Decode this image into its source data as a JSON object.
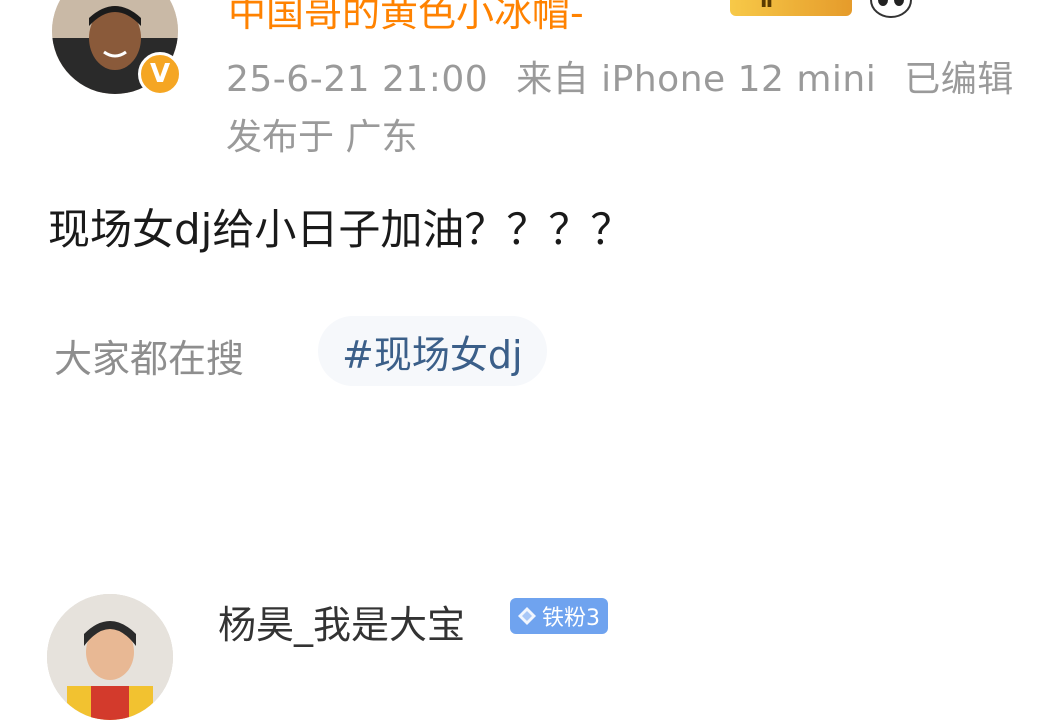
{
  "post": {
    "author_name": "中国哥的黄色小冰帽-",
    "verified_badge": "V",
    "level_badge": "Ⅱ",
    "timestamp": "25-6-21 21:00",
    "source": "来自 iPhone 12 mini",
    "edited": "已编辑",
    "location": "发布于 广东",
    "text": "现场女dj给小日子加油？？？？"
  },
  "search": {
    "label": "大家都在搜",
    "hashtag": "#现场女dj"
  },
  "comment": {
    "author_name": "杨昊_我是大宝",
    "fan_badge": "铁粉3"
  },
  "colors": {
    "username": "#ff8200",
    "meta": "#9a9a9a",
    "hashtag": "#3b5f89",
    "fan_badge": "#6fa3ef",
    "verified": "#f5a623"
  },
  "icons": [
    "verified-v-icon",
    "level-crown-icon",
    "panda-icon",
    "diamond-icon"
  ]
}
